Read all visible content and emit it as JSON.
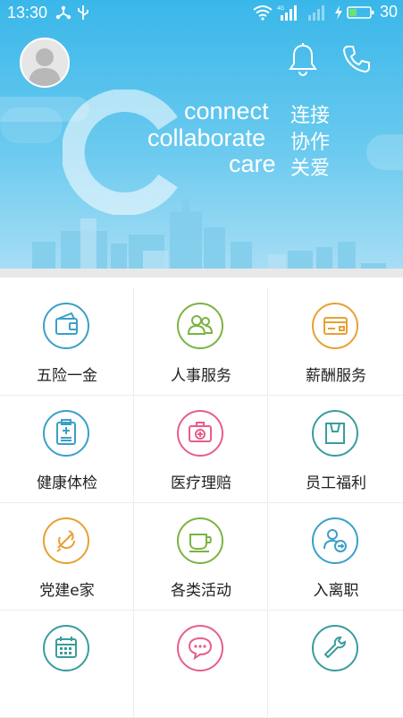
{
  "status_bar": {
    "time": "13:30",
    "battery_level": "30",
    "icons": [
      "usb-tether-icon",
      "usb-icon",
      "wifi-icon",
      "cell-signal-4g-icon",
      "cell-signal-icon",
      "charging-icon",
      "battery-icon"
    ]
  },
  "header": {
    "avatar": "avatar-placeholder",
    "actions": [
      "bell-icon",
      "phone-icon"
    ]
  },
  "banner": {
    "lines": [
      {
        "en": "connect",
        "cn": "连接"
      },
      {
        "en": "collaborate",
        "cn": "协作"
      },
      {
        "en": "care",
        "cn": "关爱"
      }
    ]
  },
  "services": [
    {
      "label": "五险一金",
      "icon": "wallet-icon",
      "color": "#3aa0c8"
    },
    {
      "label": "人事服务",
      "icon": "people-icon",
      "color": "#7cb342"
    },
    {
      "label": "薪酬服务",
      "icon": "card-icon",
      "color": "#e8a033"
    },
    {
      "label": "健康体检",
      "icon": "clipboard-icon",
      "color": "#3aa0c8"
    },
    {
      "label": "医疗理赔",
      "icon": "medical-kit-icon",
      "color": "#e85d8a"
    },
    {
      "label": "员工福利",
      "icon": "shopping-bag-icon",
      "color": "#3a9c9c"
    },
    {
      "label": "党建e家",
      "icon": "party-emblem-icon",
      "color": "#e8a033"
    },
    {
      "label": "各类活动",
      "icon": "coffee-cup-icon",
      "color": "#7cb342"
    },
    {
      "label": "入离职",
      "icon": "user-transfer-icon",
      "color": "#3aa0c8"
    },
    {
      "label": "",
      "icon": "calendar-icon",
      "color": "#3a9c9c"
    },
    {
      "label": "",
      "icon": "chat-bubble-icon",
      "color": "#e85d8a"
    },
    {
      "label": "",
      "icon": "wrench-icon",
      "color": "#3a9c9c"
    }
  ]
}
